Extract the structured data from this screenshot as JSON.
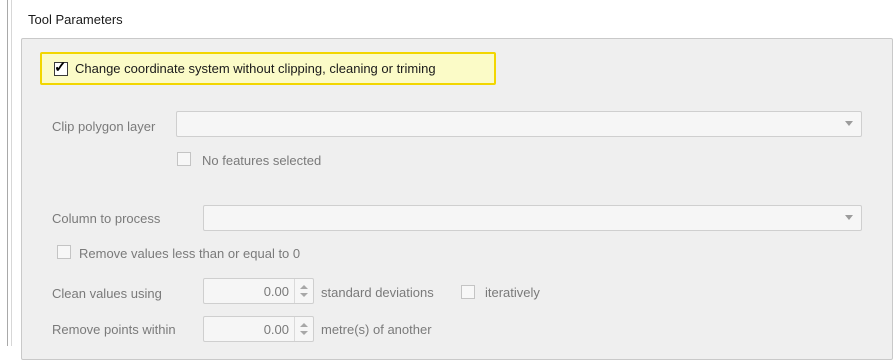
{
  "group": {
    "title": "Tool Parameters"
  },
  "change_coord": {
    "label": "Change coordinate system without clipping, cleaning or triming",
    "checked": true
  },
  "clip_layer": {
    "label": "Clip polygon layer",
    "value": ""
  },
  "no_features": {
    "label": "No features selected",
    "checked": false
  },
  "column": {
    "label": "Column to process",
    "value": ""
  },
  "remove_values": {
    "label": "Remove values less than or equal to 0",
    "checked": false
  },
  "clean_values": {
    "label": "Clean values using",
    "value": "0.00",
    "unit_label": "standard deviations",
    "iteratively_label": "iteratively",
    "iteratively_checked": false
  },
  "remove_points": {
    "label": "Remove points within",
    "value": "0.00",
    "unit_label": "metre(s) of another"
  },
  "colors": {
    "highlight_border": "#f2d600",
    "highlight_fill": "#fbfbc7",
    "panel_bg": "#efefef"
  }
}
